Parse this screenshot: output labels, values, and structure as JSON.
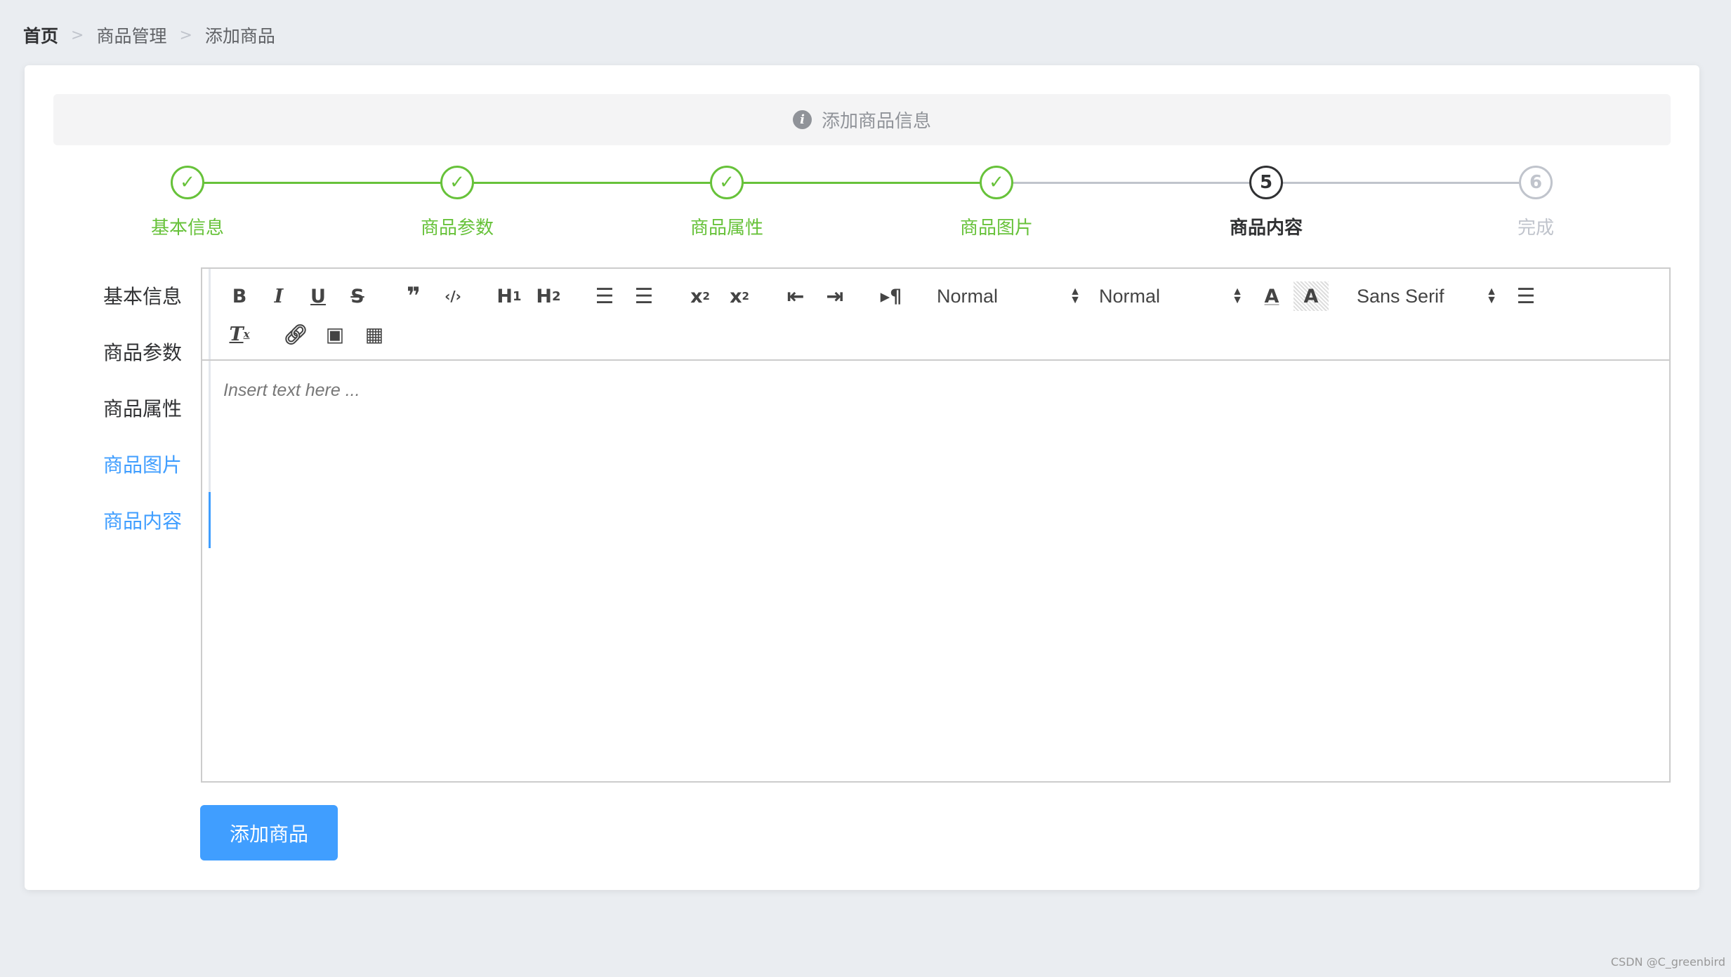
{
  "breadcrumb": [
    "首页",
    "商品管理",
    "添加商品"
  ],
  "alert": {
    "icon": "info-icon",
    "text": "添加商品信息"
  },
  "steps": [
    {
      "num": "1",
      "label": "基本信息",
      "status": "success"
    },
    {
      "num": "2",
      "label": "商品参数",
      "status": "success"
    },
    {
      "num": "3",
      "label": "商品属性",
      "status": "success"
    },
    {
      "num": "4",
      "label": "商品图片",
      "status": "success"
    },
    {
      "num": "5",
      "label": "商品内容",
      "status": "process"
    },
    {
      "num": "6",
      "label": "完成",
      "status": "wait"
    }
  ],
  "tabs": [
    {
      "label": "基本信息"
    },
    {
      "label": "商品参数"
    },
    {
      "label": "商品属性"
    },
    {
      "label": "商品图片"
    },
    {
      "label": "商品内容",
      "active": true
    }
  ],
  "editor": {
    "placeholder": "Insert text here ...",
    "header_select": "Normal",
    "size_select": "Normal",
    "font_select": "Sans Serif",
    "toolbar_icons": [
      "bold",
      "italic",
      "underline",
      "strike",
      "blockquote",
      "code-block",
      "h1",
      "h2",
      "ordered-list",
      "bullet-list",
      "subscript",
      "superscript",
      "outdent",
      "indent",
      "direction",
      "header",
      "size",
      "color",
      "background",
      "font",
      "align",
      "clean",
      "link",
      "image",
      "video"
    ]
  },
  "submit_label": "添加商品",
  "watermark": "CSDN @C_greenbird",
  "colors": {
    "success": "#67c23a",
    "primary": "#409eff",
    "wait": "#c0c4cc"
  }
}
